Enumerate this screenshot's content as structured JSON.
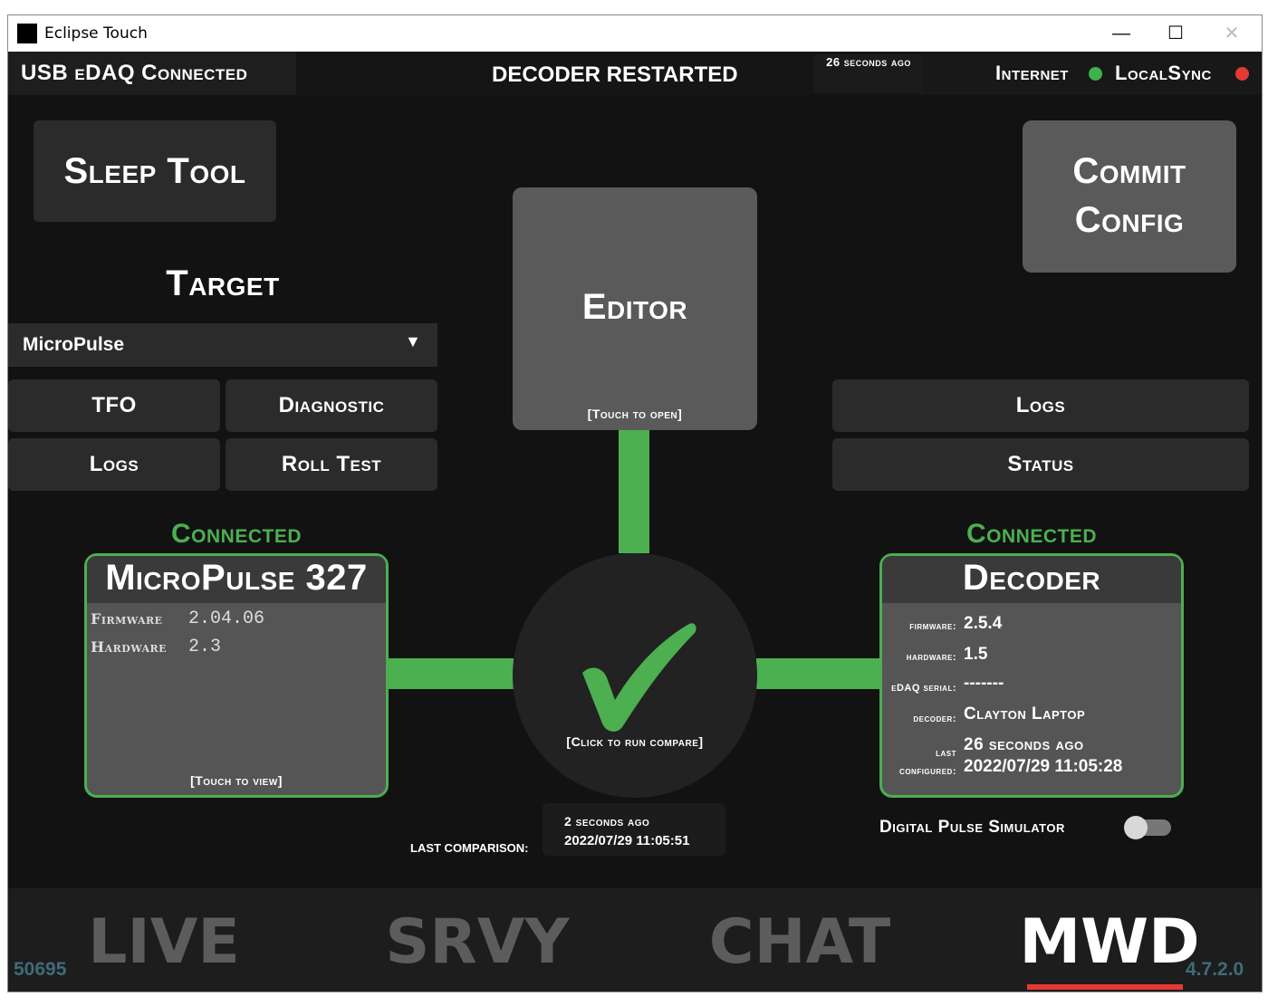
{
  "window": {
    "title": "Eclipse Touch",
    "minimize": "—",
    "maximize": "☐",
    "close": "✕"
  },
  "status": {
    "usb": "USB eDAQ Connected",
    "message": "DECODER RESTARTED",
    "time_ago": "26 seconds ago",
    "internet_label": "Internet",
    "localsync_label": "LocalSync",
    "internet_color": "#3cb44b",
    "localsync_color": "#e53935"
  },
  "left": {
    "sleep_tool": "Sleep Tool",
    "target_label": "Target",
    "target_value": "MicroPulse",
    "buttons": [
      "TFO",
      "Diagnostic",
      "Logs",
      "Roll Test"
    ]
  },
  "right": {
    "commit_line1": "Commit",
    "commit_line2": "Config",
    "buttons": [
      "Logs",
      "Status"
    ]
  },
  "editor": {
    "label": "Editor",
    "hint": "[Touch to open]"
  },
  "compare": {
    "hint": "[Click to run compare]",
    "last_label": "LAST COMPARISON:",
    "ago": "2 seconds ago",
    "timestamp": "2022/07/29 11:05:51"
  },
  "micropulse": {
    "status": "Connected",
    "title": "MicroPulse 327",
    "firmware_label": "Firmware",
    "firmware_value": "2.04.06",
    "hardware_label": "Hardware",
    "hardware_value": "2.3",
    "hint": "[Touch to view]"
  },
  "decoder": {
    "status": "Connected",
    "title": "Decoder",
    "firmware_label": "firmware:",
    "firmware_value": "2.5.4",
    "hardware_label": "hardware:",
    "hardware_value": "1.5",
    "edaq_label": "eDAQ serial:",
    "edaq_value": "-------",
    "decoder_label": "decoder:",
    "decoder_value": "Clayton Laptop",
    "last_label": "last",
    "configured_label": "configured:",
    "last_ago": "26 seconds ago",
    "last_timestamp": "2022/07/29 11:05:28"
  },
  "simulator": {
    "label": "Digital Pulse Simulator",
    "enabled": false
  },
  "bottom_nav": {
    "left_number": "50695",
    "tabs": [
      "LIVE",
      "SRVY",
      "CHAT",
      "MWD"
    ],
    "active_tab": "MWD",
    "version": "4.7.2.0",
    "accent": "#e53935"
  }
}
